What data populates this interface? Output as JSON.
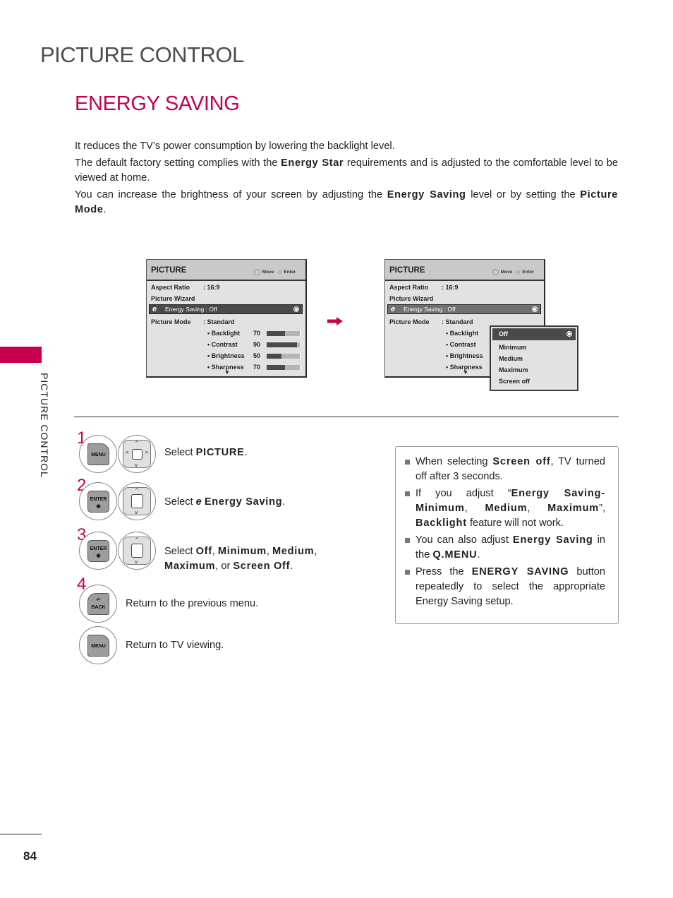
{
  "header": {
    "page_title": "PICTURE CONTROL",
    "section_title": "ENERGY SAVING",
    "side_tab_label": "PICTURE CONTROL"
  },
  "intro": {
    "p1": "It reduces the TV’s power consumption by lowering the backlight level.",
    "p2_before": "The default factory setting complies with the ",
    "p2_bold": "Energy Star",
    "p2_after": " requirements and is adjusted to the comfortable level to be viewed at home.",
    "p3_before": "You can increase the brightness of your screen by adjusting the ",
    "p3_bold1": "Energy Saving",
    "p3_mid": " level or by setting the ",
    "p3_bold2": "Picture Mode",
    "p3_after": "."
  },
  "osd": {
    "title": "PICTURE",
    "hint_move": "Move",
    "hint_enter": "Enter",
    "aspect_ratio_label": "Aspect Ratio",
    "aspect_ratio_value": ": 16:9",
    "picture_wizard_label": "Picture Wizard",
    "energy_icon": "e",
    "energy_saving_text": "Energy Saving : Off",
    "picture_mode_label": "Picture Mode",
    "picture_mode_value": ": Standard",
    "settings": [
      {
        "label": "• Backlight",
        "value": "70",
        "level": 0.55
      },
      {
        "label": "• Contrast",
        "value": "90",
        "level": 0.92
      },
      {
        "label": "• Brightness",
        "value": "50",
        "level": 0.45
      },
      {
        "label": "• Sharpness",
        "value": "70",
        "level": 0.55
      }
    ],
    "more_indicator": "▼"
  },
  "popup": {
    "selected": "Off",
    "options": [
      "Off",
      "Minimum",
      "Medium",
      "Maximum",
      "Screen off"
    ]
  },
  "colors": {
    "accent": "#c4004f",
    "title_gray": "#4d4d4f",
    "osd_bg": "#e2e2e2",
    "osd_highlight": "#4a4a4a"
  },
  "steps": [
    {
      "number": "1",
      "key": "MENU",
      "text_before": "Select ",
      "bold": "PICTURE",
      "text_after": "."
    },
    {
      "number": "2",
      "key": "ENTER",
      "text_before": "Select ",
      "icon": "e",
      "bold": "Energy Saving",
      "text_after": "."
    },
    {
      "number": "3",
      "key": "ENTER",
      "text_before": "Select ",
      "bold1": "Off",
      "sep1": ", ",
      "bold2": "Minimum",
      "sep2": ", ",
      "bold3": "Medium",
      "sep3": ",",
      "bold4": "Maximum",
      "sep4": ", or ",
      "bold5": "Screen Off",
      "text_after": "."
    },
    {
      "number": "4",
      "key": "BACK",
      "text": "Return to the previous menu."
    },
    {
      "key": "MENU",
      "text": "Return to TV viewing."
    }
  ],
  "notes": [
    {
      "before": "When selecting ",
      "bold": "Screen off",
      "after": ", TV turned off after 3 seconds."
    },
    {
      "before": "If you adjust “",
      "bold": "Energy Saving-Minimum",
      "mid1": ", ",
      "bold2": "Medium",
      "mid2": ", ",
      "bold3": "Maximum",
      "mid3": "”, ",
      "bold4": "Backlight",
      "after": " feature will not work."
    },
    {
      "before": "You can also adjust ",
      "bold": "Energy Saving",
      "mid": " in the ",
      "bold2": "Q.MENU",
      "after": "."
    },
    {
      "before": "Press the ",
      "bold": "ENERGY SAVING",
      "after": " button repeatedly to select the appropriate Energy Saving setup."
    }
  ],
  "footer": {
    "page_number": "84"
  }
}
